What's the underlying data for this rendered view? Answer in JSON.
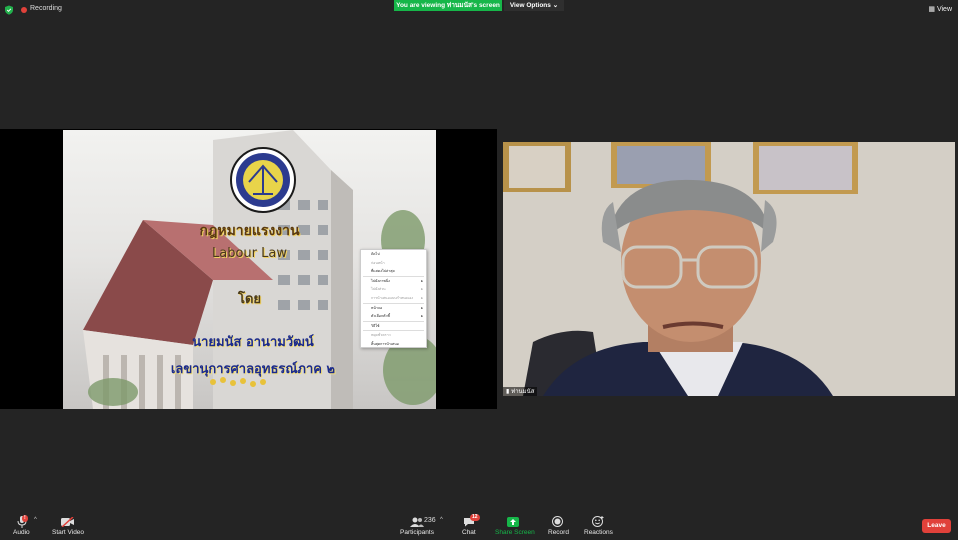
{
  "topbar": {
    "recording_label": "Recording",
    "viewing_banner": "You are viewing ท่านมนัส's screen",
    "view_options_label": "View Options ⌄",
    "view_label": "View"
  },
  "slide": {
    "title_th": "กฎหมายแรงงาน",
    "title_en": "Labour Law",
    "by": "โดย",
    "presenter_name": "นายมนัส  อานามวัฒน์",
    "presenter_position": "เลขานุการศาลอุทธรณ์ภาค ๒"
  },
  "context_menu": {
    "items": [
      {
        "label": "ถัดไป",
        "dim": false,
        "arrow": false
      },
      {
        "label": "ก่อนหน้า",
        "dim": true,
        "arrow": false
      },
      {
        "label": "ที่แสดงไปล่าสุด",
        "dim": false,
        "arrow": false
      },
      {
        "label": "ไปยังภาพนิ่ง",
        "dim": false,
        "arrow": true
      },
      {
        "label": "ไปยังส่วน",
        "dim": true,
        "arrow": true
      },
      {
        "label": "การนำเสนอแบบกำหนดเอง",
        "dim": true,
        "arrow": true
      },
      {
        "label": "หน้าจอ",
        "dim": false,
        "arrow": true
      },
      {
        "label": "ตัวเลือกตัวชี้",
        "dim": false,
        "arrow": true
      },
      {
        "label": "วิธีใช้",
        "dim": false,
        "arrow": false
      },
      {
        "label": "หยุดชั่วคราว",
        "dim": true,
        "arrow": false
      },
      {
        "label": "สิ้นสุดการนำเสนอ",
        "dim": false,
        "arrow": false
      }
    ]
  },
  "camera": {
    "participant_name": "ท่านมนัส"
  },
  "toolbar": {
    "audio_label": "Audio",
    "video_label": "Start Video",
    "participants_label": "Participants",
    "participants_count": "236",
    "chat_label": "Chat",
    "chat_badge": "12",
    "share_label": "Share Screen",
    "record_label": "Record",
    "reactions_label": "Reactions",
    "leave_label": "Leave"
  },
  "colors": {
    "background": "#242424",
    "share_green": "#16b649",
    "leave_red": "#e0413a"
  }
}
